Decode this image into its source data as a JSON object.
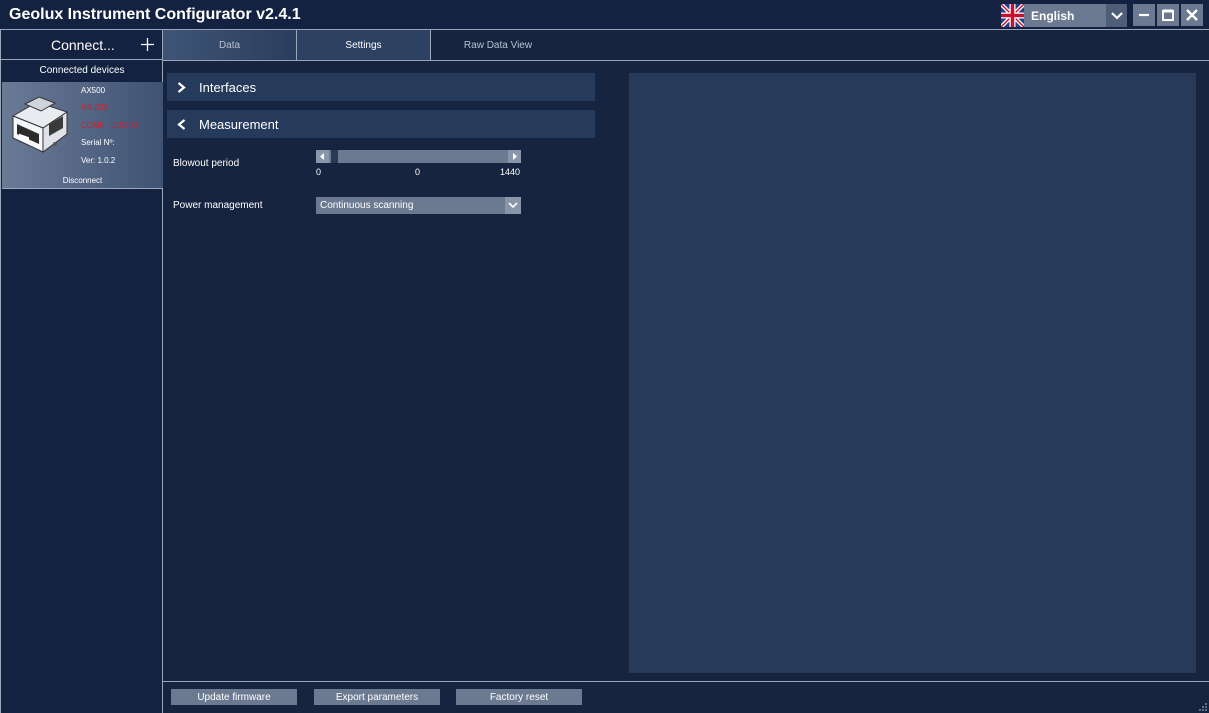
{
  "app": {
    "title": "Geolux Instrument Configurator v2.4.1",
    "language": "English"
  },
  "left_panel": {
    "connect_label": "Connect...",
    "connect_icon": "plus-icon",
    "connected_devices_label": "Connected devices",
    "device": {
      "name": "AX500",
      "protocol": "RS-232",
      "port": "COM5 - 115200",
      "serial": "Serial Nº:",
      "version": "Ver: 1.0.2",
      "disconnect_label": "Disconnect"
    }
  },
  "tabs": [
    {
      "label": "Data",
      "active": false
    },
    {
      "label": "Settings",
      "active": true
    },
    {
      "label": "Raw Data View",
      "active": false
    }
  ],
  "sections": {
    "interfaces": {
      "label": "Interfaces",
      "expanded": false
    },
    "measurement": {
      "label": "Measurement",
      "expanded": true
    }
  },
  "measurement": {
    "blowout": {
      "label": "Blowout period",
      "min_label": "0",
      "value_label": "0",
      "max_label": "1440",
      "value": 0,
      "min": 0,
      "max": 1440
    },
    "power": {
      "label": "Power management",
      "selected": "Continuous scanning"
    }
  },
  "bottom": {
    "update_firmware": "Update firmware",
    "export_parameters": "Export parameters",
    "factory_reset": "Factory reset"
  },
  "colors": {
    "background": "#16243f",
    "panel": "#273a5a",
    "control": "#6b7a90",
    "error_text": "#d0202a"
  }
}
